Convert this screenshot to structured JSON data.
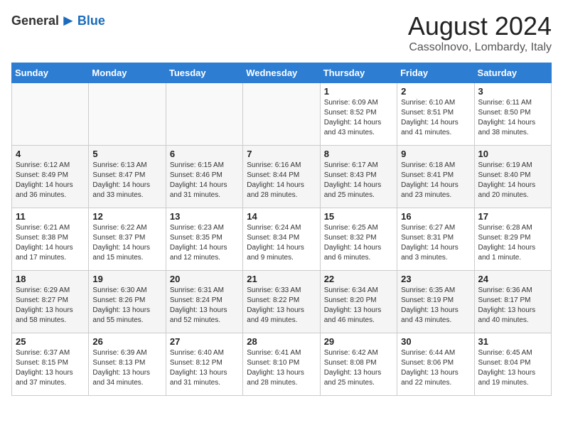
{
  "logo": {
    "general": "General",
    "blue": "Blue"
  },
  "title": {
    "month_year": "August 2024",
    "location": "Cassolnovo, Lombardy, Italy"
  },
  "days_of_week": [
    "Sunday",
    "Monday",
    "Tuesday",
    "Wednesday",
    "Thursday",
    "Friday",
    "Saturday"
  ],
  "weeks": [
    [
      {
        "day": "",
        "info": ""
      },
      {
        "day": "",
        "info": ""
      },
      {
        "day": "",
        "info": ""
      },
      {
        "day": "",
        "info": ""
      },
      {
        "day": "1",
        "info": "Sunrise: 6:09 AM\nSunset: 8:52 PM\nDaylight: 14 hours\nand 43 minutes."
      },
      {
        "day": "2",
        "info": "Sunrise: 6:10 AM\nSunset: 8:51 PM\nDaylight: 14 hours\nand 41 minutes."
      },
      {
        "day": "3",
        "info": "Sunrise: 6:11 AM\nSunset: 8:50 PM\nDaylight: 14 hours\nand 38 minutes."
      }
    ],
    [
      {
        "day": "4",
        "info": "Sunrise: 6:12 AM\nSunset: 8:49 PM\nDaylight: 14 hours\nand 36 minutes."
      },
      {
        "day": "5",
        "info": "Sunrise: 6:13 AM\nSunset: 8:47 PM\nDaylight: 14 hours\nand 33 minutes."
      },
      {
        "day": "6",
        "info": "Sunrise: 6:15 AM\nSunset: 8:46 PM\nDaylight: 14 hours\nand 31 minutes."
      },
      {
        "day": "7",
        "info": "Sunrise: 6:16 AM\nSunset: 8:44 PM\nDaylight: 14 hours\nand 28 minutes."
      },
      {
        "day": "8",
        "info": "Sunrise: 6:17 AM\nSunset: 8:43 PM\nDaylight: 14 hours\nand 25 minutes."
      },
      {
        "day": "9",
        "info": "Sunrise: 6:18 AM\nSunset: 8:41 PM\nDaylight: 14 hours\nand 23 minutes."
      },
      {
        "day": "10",
        "info": "Sunrise: 6:19 AM\nSunset: 8:40 PM\nDaylight: 14 hours\nand 20 minutes."
      }
    ],
    [
      {
        "day": "11",
        "info": "Sunrise: 6:21 AM\nSunset: 8:38 PM\nDaylight: 14 hours\nand 17 minutes."
      },
      {
        "day": "12",
        "info": "Sunrise: 6:22 AM\nSunset: 8:37 PM\nDaylight: 14 hours\nand 15 minutes."
      },
      {
        "day": "13",
        "info": "Sunrise: 6:23 AM\nSunset: 8:35 PM\nDaylight: 14 hours\nand 12 minutes."
      },
      {
        "day": "14",
        "info": "Sunrise: 6:24 AM\nSunset: 8:34 PM\nDaylight: 14 hours\nand 9 minutes."
      },
      {
        "day": "15",
        "info": "Sunrise: 6:25 AM\nSunset: 8:32 PM\nDaylight: 14 hours\nand 6 minutes."
      },
      {
        "day": "16",
        "info": "Sunrise: 6:27 AM\nSunset: 8:31 PM\nDaylight: 14 hours\nand 3 minutes."
      },
      {
        "day": "17",
        "info": "Sunrise: 6:28 AM\nSunset: 8:29 PM\nDaylight: 14 hours\nand 1 minute."
      }
    ],
    [
      {
        "day": "18",
        "info": "Sunrise: 6:29 AM\nSunset: 8:27 PM\nDaylight: 13 hours\nand 58 minutes."
      },
      {
        "day": "19",
        "info": "Sunrise: 6:30 AM\nSunset: 8:26 PM\nDaylight: 13 hours\nand 55 minutes."
      },
      {
        "day": "20",
        "info": "Sunrise: 6:31 AM\nSunset: 8:24 PM\nDaylight: 13 hours\nand 52 minutes."
      },
      {
        "day": "21",
        "info": "Sunrise: 6:33 AM\nSunset: 8:22 PM\nDaylight: 13 hours\nand 49 minutes."
      },
      {
        "day": "22",
        "info": "Sunrise: 6:34 AM\nSunset: 8:20 PM\nDaylight: 13 hours\nand 46 minutes."
      },
      {
        "day": "23",
        "info": "Sunrise: 6:35 AM\nSunset: 8:19 PM\nDaylight: 13 hours\nand 43 minutes."
      },
      {
        "day": "24",
        "info": "Sunrise: 6:36 AM\nSunset: 8:17 PM\nDaylight: 13 hours\nand 40 minutes."
      }
    ],
    [
      {
        "day": "25",
        "info": "Sunrise: 6:37 AM\nSunset: 8:15 PM\nDaylight: 13 hours\nand 37 minutes."
      },
      {
        "day": "26",
        "info": "Sunrise: 6:39 AM\nSunset: 8:13 PM\nDaylight: 13 hours\nand 34 minutes."
      },
      {
        "day": "27",
        "info": "Sunrise: 6:40 AM\nSunset: 8:12 PM\nDaylight: 13 hours\nand 31 minutes."
      },
      {
        "day": "28",
        "info": "Sunrise: 6:41 AM\nSunset: 8:10 PM\nDaylight: 13 hours\nand 28 minutes."
      },
      {
        "day": "29",
        "info": "Sunrise: 6:42 AM\nSunset: 8:08 PM\nDaylight: 13 hours\nand 25 minutes."
      },
      {
        "day": "30",
        "info": "Sunrise: 6:44 AM\nSunset: 8:06 PM\nDaylight: 13 hours\nand 22 minutes."
      },
      {
        "day": "31",
        "info": "Sunrise: 6:45 AM\nSunset: 8:04 PM\nDaylight: 13 hours\nand 19 minutes."
      }
    ]
  ]
}
